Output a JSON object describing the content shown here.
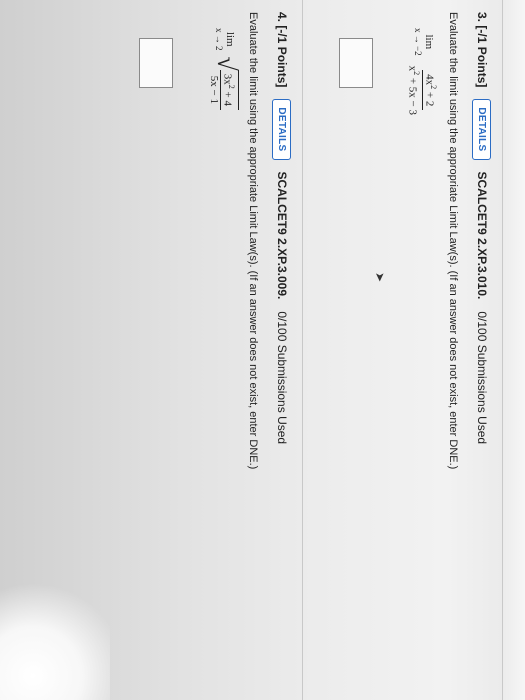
{
  "questions": [
    {
      "number": "3.",
      "points": "[-/1 Points]",
      "details_label": "DETAILS",
      "code": "SCALCET9 2.XP.3.010.",
      "submissions": "0/100 Submissions Used",
      "prompt": "Evaluate the limit using the appropriate Limit Law(s). (If an answer does not exist, enter DNE.)",
      "limit_word": "lim",
      "limit_sub": "x → −2",
      "numerator": "4x",
      "numerator_exp": "2",
      "numerator_tail": " + 2",
      "denominator": "x",
      "denominator_exp": "2",
      "denominator_tail": " + 5x − 3"
    },
    {
      "number": "4.",
      "points": "[-/1 Points]",
      "details_label": "DETAILS",
      "code": "SCALCET9 2.XP.3.009.",
      "submissions": "0/100 Submissions Used",
      "prompt": "Evaluate the limit using the appropriate Limit Law(s). (If an answer does not exist, enter DNE.)",
      "limit_word": "lim",
      "limit_sub": "x → 2",
      "numerator": "3x",
      "numerator_exp": "2",
      "numerator_tail": " + 4",
      "denominator": "5x − 1"
    }
  ],
  "colors": {
    "accent": "#2b6cc4",
    "background": "#ececec"
  },
  "icons": {
    "cursor": "mouse-pointer-icon"
  }
}
